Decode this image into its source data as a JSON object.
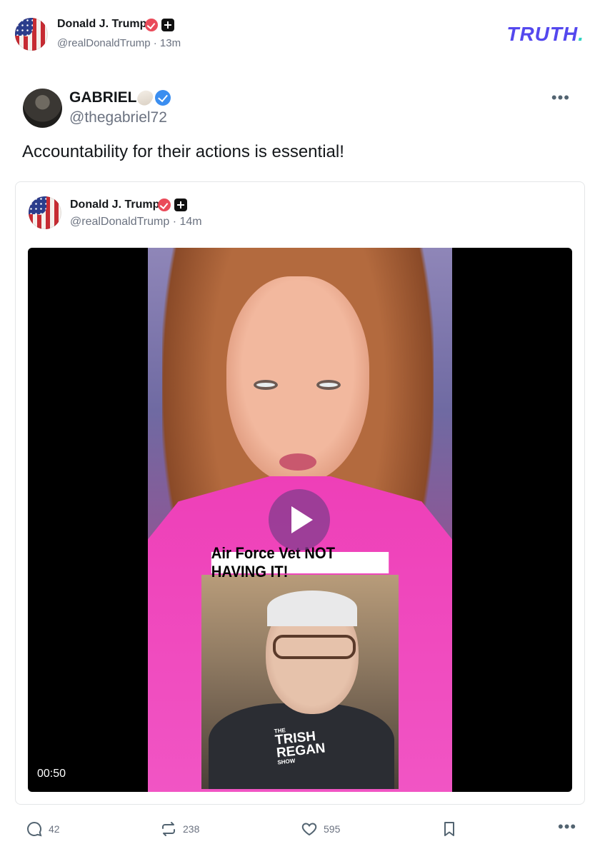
{
  "header": {
    "name": "Donald J. Trump",
    "handle": "@realDonaldTrump",
    "time": "13m",
    "logo_text": "TRUTH",
    "logo_dot": ".",
    "colors": {
      "logo": "#5448ee",
      "logo_dot": "#2fd3c2",
      "verified_red": "#ea4b5a"
    }
  },
  "post": {
    "author_name": "GABRIEL",
    "handle": "@thegabriel72",
    "more_label": "•••",
    "text": "Accountability for their actions is essential!",
    "icons": [
      "shell-emoji-icon",
      "verified-blue-icon"
    ]
  },
  "quoted": {
    "name": "Donald J. Trump",
    "handle": "@realDonaldTrump",
    "time": "14m",
    "video": {
      "caption": "Air Force Vet NOT HAVING IT!",
      "logo_the": "THE",
      "logo_trish": "TRISH",
      "logo_regan": "REGAN",
      "logo_show": "SHOW",
      "duration": "00:50"
    }
  },
  "actions": {
    "replies": "42",
    "retruths": "238",
    "likes": "595",
    "more_label": "•••"
  }
}
